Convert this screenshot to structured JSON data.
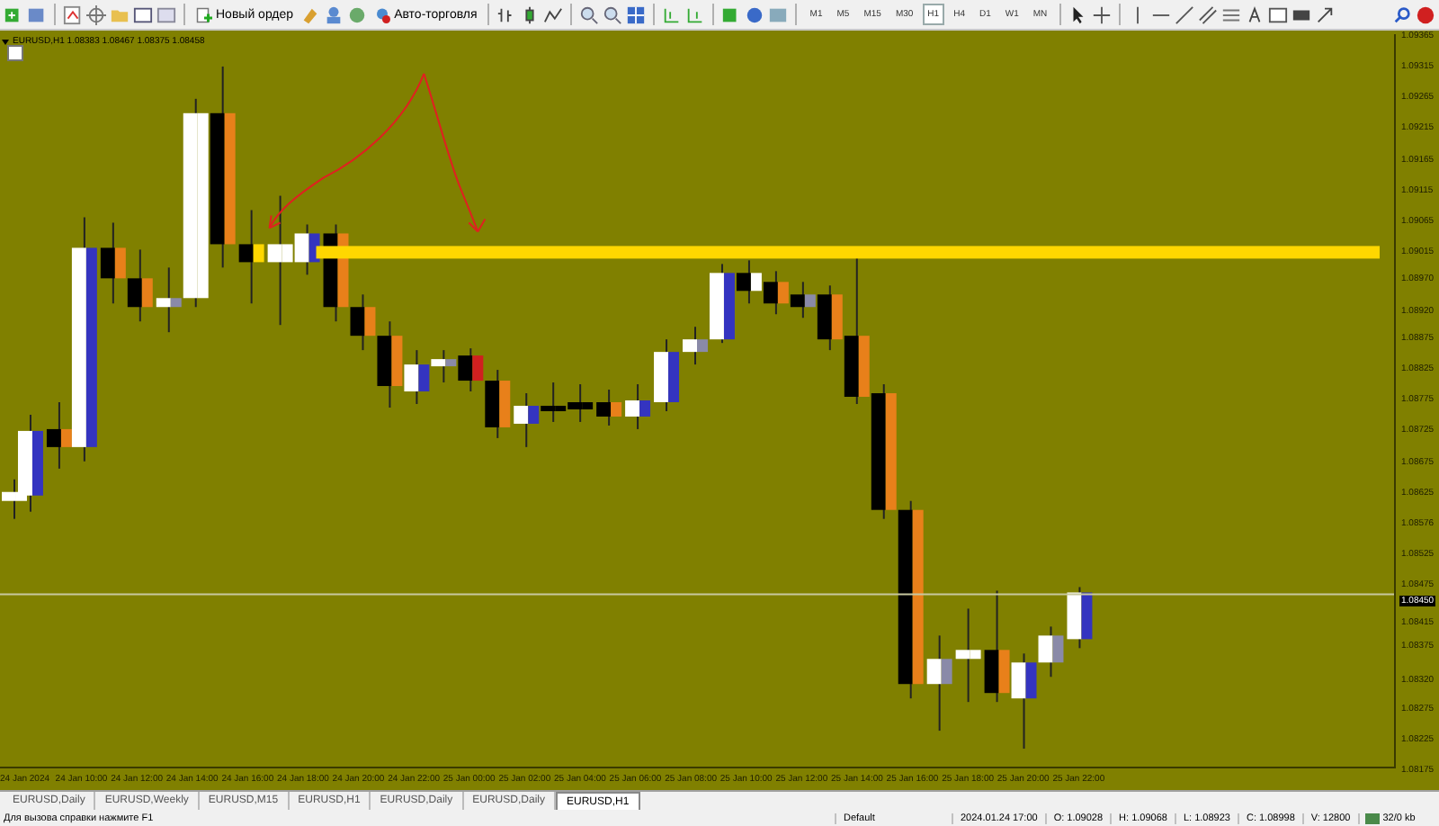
{
  "toolbar": {
    "buttons": [
      {
        "kind": "order",
        "label": "Новый ордер"
      },
      {
        "kind": "auto",
        "label": "Авто-торговля"
      }
    ],
    "timeframes": [
      {
        "label": "M1",
        "selected": false
      },
      {
        "label": "M5",
        "selected": false
      },
      {
        "label": "M15",
        "selected": false
      },
      {
        "label": "M30",
        "selected": false
      },
      {
        "label": "H1",
        "selected": true
      },
      {
        "label": "H4",
        "selected": false
      },
      {
        "label": "D1",
        "selected": false
      },
      {
        "label": "W1",
        "selected": false
      },
      {
        "label": "MN",
        "selected": false
      }
    ]
  },
  "chart": {
    "symbol": "EURUSD,H1",
    "quote": "1.08383 1.08467 1.08375 1.08458",
    "price_axis": [
      "1.09365",
      "1.09315",
      "1.09265",
      "1.09215",
      "1.09165",
      "1.09115",
      "1.09065",
      "1.09015",
      "1.08970",
      "1.08920",
      "1.08875",
      "1.08825",
      "1.08775",
      "1.08725",
      "1.08675",
      "1.08625",
      "1.08576",
      "1.08525",
      "1.08475",
      "1.08415",
      "1.08375",
      "1.08320",
      "1.08275",
      "1.08225",
      "1.08175"
    ],
    "current_price": "1.08450",
    "time_axis": [
      "24 Jan 2024",
      "24 Jan 10:00",
      "24 Jan 12:00",
      "24 Jan 14:00",
      "24 Jan 16:00",
      "24 Jan 18:00",
      "24 Jan 20:00",
      "24 Jan 22:00",
      "25 Jan 00:00",
      "25 Jan 02:00",
      "25 Jan 04:00",
      "25 Jan 06:00",
      "25 Jan 08:00",
      "25 Jan 10:00",
      "25 Jan 12:00",
      "25 Jan 14:00",
      "25 Jan 16:00",
      "25 Jan 18:00",
      "25 Jan 20:00",
      "25 Jan 22:00"
    ]
  },
  "tabs": [
    {
      "label": "EURUSD,Daily",
      "selected": false
    },
    {
      "label": "EURUSD,Weekly",
      "selected": false
    },
    {
      "label": "EURUSD,M15",
      "selected": false
    },
    {
      "label": "EURUSD,H1",
      "selected": false
    },
    {
      "label": "EURUSD,Daily",
      "selected": false
    },
    {
      "label": "EURUSD,Daily",
      "selected": false
    },
    {
      "label": "EURUSD,H1",
      "selected": true
    }
  ],
  "status_bar": {
    "help": "Для вызова справки нажмите F1",
    "profile": "Default",
    "fields": [
      "2024.01.24 17:00",
      "O: 1.09028",
      "H: 1.09068",
      "L: 1.08923",
      "C: 1.08998",
      "V: 12800"
    ],
    "traffic": "32/0 kb"
  }
}
